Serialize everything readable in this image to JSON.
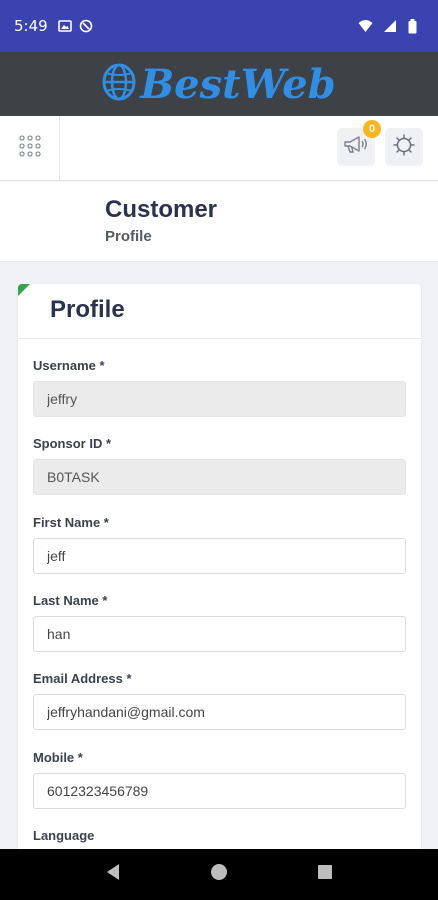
{
  "status_bar": {
    "time": "5:49",
    "icons": [
      "gallery-icon",
      "sync-icon",
      "wifi-icon",
      "signal-icon",
      "battery-icon"
    ]
  },
  "brand": {
    "name": "BestWeb",
    "color": "#2f8fe6"
  },
  "toolbar": {
    "notification_count": "0",
    "icons": [
      "grid-menu-icon",
      "megaphone-icon",
      "settings-gear-icon"
    ]
  },
  "page_header": {
    "title": "Customer",
    "subtitle": "Profile"
  },
  "form": {
    "title": "Profile",
    "fields": [
      {
        "label": "Username *",
        "value": "jeffry",
        "readonly": true
      },
      {
        "label": "Sponsor ID *",
        "value": "B0TASK",
        "readonly": true
      },
      {
        "label": "First Name *",
        "value": "jeff",
        "readonly": false
      },
      {
        "label": "Last Name *",
        "value": "han",
        "readonly": false
      },
      {
        "label": "Email Address *",
        "value": "jeffryhandani@gmail.com",
        "readonly": false
      },
      {
        "label": "Mobile *",
        "value": "6012323456789",
        "readonly": false
      },
      {
        "label": "Language",
        "value": "",
        "readonly": false
      }
    ]
  },
  "nav_bar": {
    "buttons": [
      "back-icon",
      "home-icon",
      "recents-icon"
    ]
  },
  "colors": {
    "status_bar": "#3a43b0",
    "brand_bar": "#3e4146",
    "badge": "#f8b51c",
    "accent_corner": "#2ea84f",
    "heading": "#29324f"
  }
}
